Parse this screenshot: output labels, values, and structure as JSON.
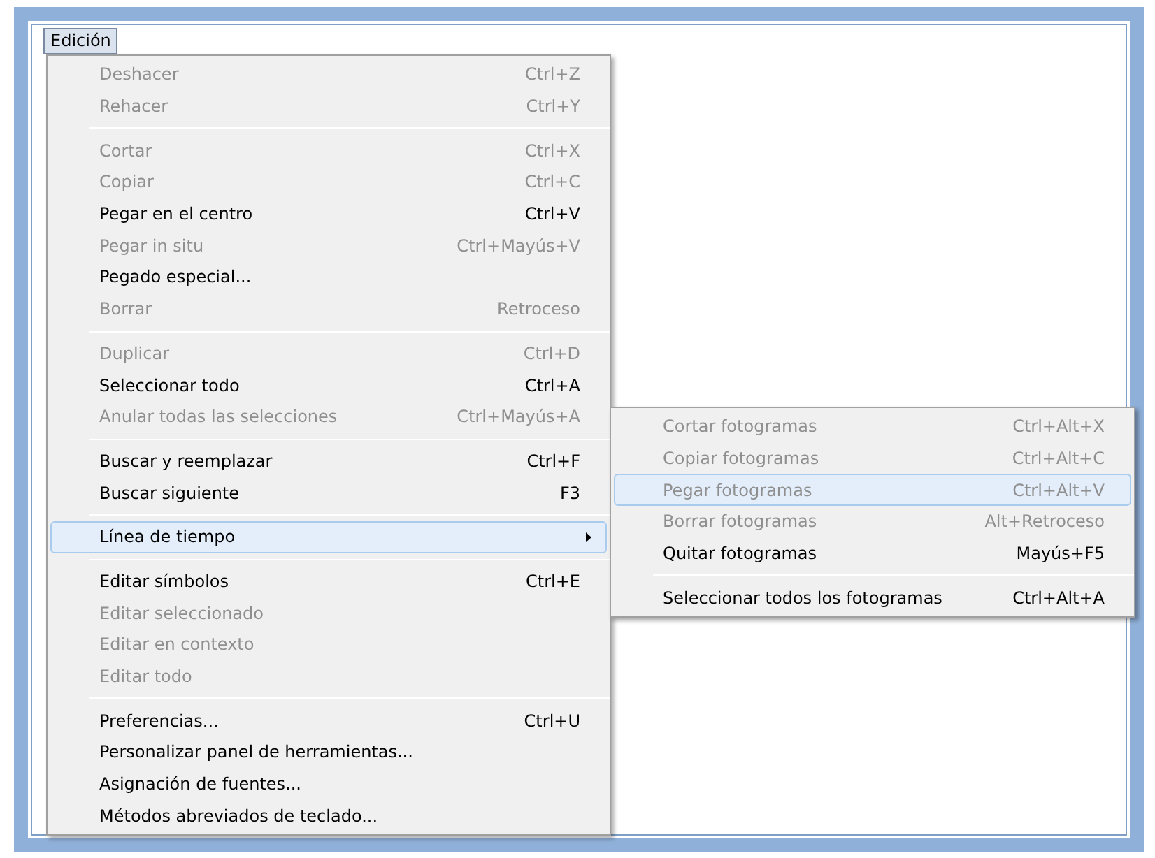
{
  "menubar": [
    {
      "label": "Edición",
      "selected": true
    }
  ],
  "menu": {
    "items": [
      {
        "kind": "item",
        "label": "Deshacer",
        "shortcut": "Ctrl+Z",
        "disabled": true,
        "selected": false,
        "submenu": false
      },
      {
        "kind": "item",
        "label": "Rehacer",
        "shortcut": "Ctrl+Y",
        "disabled": true,
        "selected": false,
        "submenu": false
      },
      {
        "kind": "separator"
      },
      {
        "kind": "item",
        "label": "Cortar",
        "shortcut": "Ctrl+X",
        "disabled": true,
        "selected": false,
        "submenu": false
      },
      {
        "kind": "item",
        "label": "Copiar",
        "shortcut": "Ctrl+C",
        "disabled": true,
        "selected": false,
        "submenu": false
      },
      {
        "kind": "item",
        "label": "Pegar en el centro",
        "shortcut": "Ctrl+V",
        "disabled": false,
        "selected": false,
        "submenu": false
      },
      {
        "kind": "item",
        "label": "Pegar in situ",
        "shortcut": "Ctrl+Mayús+V",
        "disabled": true,
        "selected": false,
        "submenu": false
      },
      {
        "kind": "item",
        "label": "Pegado especial...",
        "disabled": false,
        "selected": false,
        "submenu": false
      },
      {
        "kind": "item",
        "label": "Borrar",
        "shortcut": "Retroceso",
        "disabled": true,
        "selected": false,
        "submenu": false
      },
      {
        "kind": "separator"
      },
      {
        "kind": "item",
        "label": "Duplicar",
        "shortcut": "Ctrl+D",
        "disabled": true,
        "selected": false,
        "submenu": false
      },
      {
        "kind": "item",
        "label": "Seleccionar todo",
        "shortcut": "Ctrl+A",
        "disabled": false,
        "selected": false,
        "submenu": false
      },
      {
        "kind": "item",
        "label": "Anular todas las selecciones",
        "shortcut": "Ctrl+Mayús+A",
        "disabled": true,
        "selected": false,
        "submenu": false
      },
      {
        "kind": "separator"
      },
      {
        "kind": "item",
        "label": "Buscar y reemplazar",
        "shortcut": "Ctrl+F",
        "disabled": false,
        "selected": false,
        "submenu": false
      },
      {
        "kind": "item",
        "label": "Buscar siguiente",
        "shortcut": "F3",
        "disabled": false,
        "selected": false,
        "submenu": false
      },
      {
        "kind": "separator"
      },
      {
        "kind": "item",
        "label": "Línea de tiempo",
        "disabled": false,
        "selected": true,
        "submenu": true
      },
      {
        "kind": "separator"
      },
      {
        "kind": "item",
        "label": "Editar símbolos",
        "shortcut": "Ctrl+E",
        "disabled": false,
        "selected": false,
        "submenu": false
      },
      {
        "kind": "item",
        "label": "Editar seleccionado",
        "disabled": true,
        "selected": false,
        "submenu": false
      },
      {
        "kind": "item",
        "label": "Editar en contexto",
        "disabled": true,
        "selected": false,
        "submenu": false
      },
      {
        "kind": "item",
        "label": "Editar todo",
        "disabled": true,
        "selected": false,
        "submenu": false
      },
      {
        "kind": "separator"
      },
      {
        "kind": "item",
        "label": "Preferencias...",
        "shortcut": "Ctrl+U",
        "disabled": false,
        "selected": false,
        "submenu": false
      },
      {
        "kind": "item",
        "label": "Personalizar panel de herramientas...",
        "disabled": false,
        "selected": false,
        "submenu": false
      },
      {
        "kind": "item",
        "label": "Asignación de fuentes...",
        "disabled": false,
        "selected": false,
        "submenu": false
      },
      {
        "kind": "item",
        "label": "Métodos abreviados de teclado...",
        "disabled": false,
        "selected": false,
        "submenu": false
      }
    ]
  },
  "submenu": {
    "items": [
      {
        "kind": "item",
        "label": "Cortar fotogramas",
        "shortcut": "Ctrl+Alt+X",
        "disabled": true,
        "selected": false
      },
      {
        "kind": "item",
        "label": "Copiar fotogramas",
        "shortcut": "Ctrl+Alt+C",
        "disabled": true,
        "selected": false
      },
      {
        "kind": "item",
        "label": "Pegar fotogramas",
        "shortcut": "Ctrl+Alt+V",
        "disabled": true,
        "selected": true
      },
      {
        "kind": "item",
        "label": "Borrar fotogramas",
        "shortcut": "Alt+Retroceso",
        "disabled": true,
        "selected": false
      },
      {
        "kind": "item",
        "label": "Quitar fotogramas",
        "shortcut": "Mayús+F5",
        "disabled": false,
        "selected": false
      },
      {
        "kind": "separator"
      },
      {
        "kind": "item",
        "label": "Seleccionar todos los fotogramas",
        "shortcut": "Ctrl+Alt+A",
        "disabled": false,
        "selected": false
      }
    ]
  }
}
